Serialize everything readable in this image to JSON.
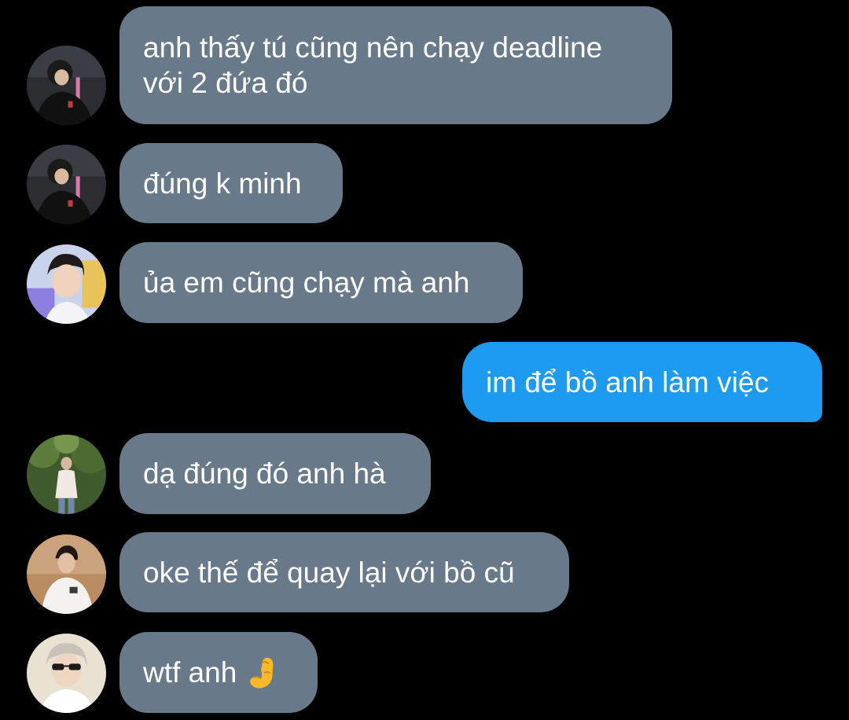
{
  "messages": [
    {
      "direction": "incoming",
      "lines": [
        "anh thấy tú cũng nên chạy deadline",
        "với 2 đứa đó"
      ]
    },
    {
      "direction": "incoming",
      "text": "đúng k minh"
    },
    {
      "direction": "incoming",
      "text": "ủa em cũng chạy mà anh"
    },
    {
      "direction": "outgoing",
      "text": "im để bồ anh làm việc"
    },
    {
      "direction": "incoming",
      "text": "dạ đúng đó anh hà"
    },
    {
      "direction": "incoming",
      "text": "oke thế để quay lại với bồ cũ"
    },
    {
      "direction": "incoming",
      "text": "wtf anh",
      "emoji": "pinching-hand-icon"
    }
  ],
  "colors": {
    "background": "#000000",
    "incoming_bubble": "#687989",
    "outgoing_bubble": "#1d9bf0",
    "text": "#ffffff"
  }
}
